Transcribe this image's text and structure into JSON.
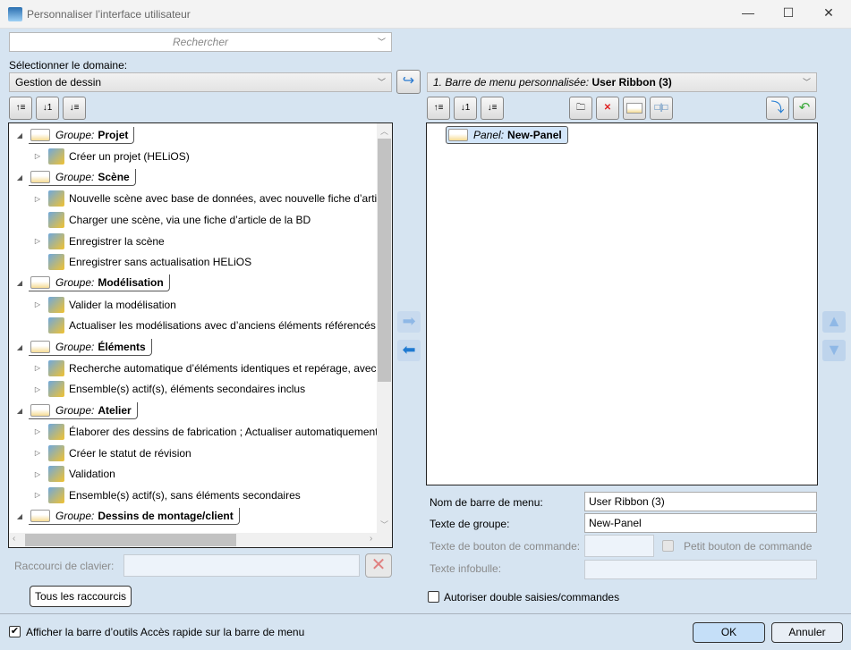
{
  "window": {
    "title": "Personnaliser l’interface utilisateur",
    "minimize": "—",
    "maximize": "☐",
    "close": "✕"
  },
  "search": {
    "placeholder": "Rechercher"
  },
  "domain": {
    "label": "Sélectionner le domaine:",
    "value": "Gestion de dessin"
  },
  "ribbon_select": {
    "prefix": "1. Barre de menu personnalisée:",
    "value": "User Ribbon (3)"
  },
  "group_prefix": "Groupe:",
  "left_tree": [
    {
      "type": "group",
      "name": "Projet"
    },
    {
      "type": "item",
      "label": "Créer un projet (HELiOS)",
      "expander": true
    },
    {
      "type": "group",
      "name": "Scène"
    },
    {
      "type": "item",
      "label": "Nouvelle scène avec base de données, avec nouvelle fiche d’article",
      "expander": true
    },
    {
      "type": "item",
      "label": "Charger une scène, via une fiche d’article de la BD",
      "expander": false
    },
    {
      "type": "item",
      "label": "Enregistrer la scène",
      "expander": true
    },
    {
      "type": "item",
      "label": "Enregistrer sans actualisation HELiOS",
      "expander": false
    },
    {
      "type": "group",
      "name": "Modélisation"
    },
    {
      "type": "item",
      "label": "Valider la modélisation",
      "expander": true
    },
    {
      "type": "item",
      "label": "Actualiser les modélisations avec d’anciens éléments référencés",
      "expander": false
    },
    {
      "type": "group",
      "name": "Éléments"
    },
    {
      "type": "item",
      "label": "Recherche automatique d’éléments identiques et repérage, avec p",
      "expander": true
    },
    {
      "type": "item",
      "label": "Ensemble(s) actif(s), éléments secondaires inclus",
      "expander": true
    },
    {
      "type": "group",
      "name": "Atelier"
    },
    {
      "type": "item",
      "label": "Élaborer des dessins de fabrication ; Actualiser automatiquement",
      "expander": true
    },
    {
      "type": "item",
      "label": "Créer le statut de révision",
      "expander": true
    },
    {
      "type": "item",
      "label": "Validation",
      "expander": true
    },
    {
      "type": "item",
      "label": "Ensemble(s) actif(s), sans éléments secondaires",
      "expander": true
    },
    {
      "type": "group",
      "name": "Dessins de montage/client"
    }
  ],
  "right_tree": {
    "panel_prefix": "Panel:",
    "panel_name": "New-Panel"
  },
  "shortcut": {
    "label": "Raccourci de clavier:",
    "value": "",
    "all_button": "Tous les raccourcis"
  },
  "form": {
    "ribbon_name_label": "Nom de barre de menu:",
    "ribbon_name_value": "User Ribbon (3)",
    "group_text_label": "Texte de groupe:",
    "group_text_value": "New-Panel",
    "button_text_label": "Texte de bouton de commande:",
    "button_text_value": "",
    "small_button_label": "Petit bouton de commande",
    "tooltip_label": "Texte infobulle:",
    "tooltip_value": "",
    "allow_double_label": "Autoriser double saisies/commandes"
  },
  "footer": {
    "quick_access_label": "Afficher la barre d’outils Accès rapide sur la barre de menu",
    "quick_access_checked": true,
    "ok": "OK",
    "cancel": "Annuler"
  }
}
